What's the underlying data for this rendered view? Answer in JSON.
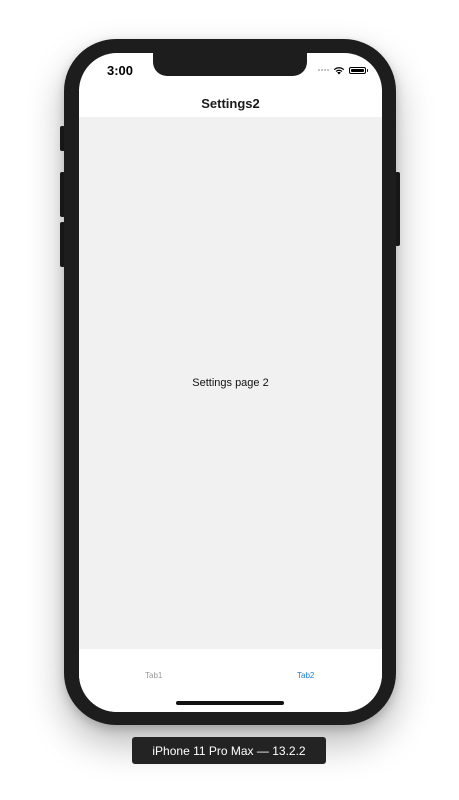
{
  "status_bar": {
    "time": "3:00",
    "icons": [
      "signal-dots-icon",
      "wifi-icon",
      "battery-icon"
    ]
  },
  "nav": {
    "title": "Settings2"
  },
  "content": {
    "text": "Settings page 2"
  },
  "tabbar": {
    "tabs": [
      {
        "label": "Tab1",
        "selected": false
      },
      {
        "label": "Tab2",
        "selected": true
      }
    ],
    "selected_color": "#1a7fdd",
    "unselected_color": "#999999"
  },
  "device_caption": "iPhone 11 Pro Max — 13.2.2",
  "colors": {
    "device_frame": "#1d1d1d",
    "content_background": "#f1f1f1",
    "bar_background": "#ffffff"
  }
}
